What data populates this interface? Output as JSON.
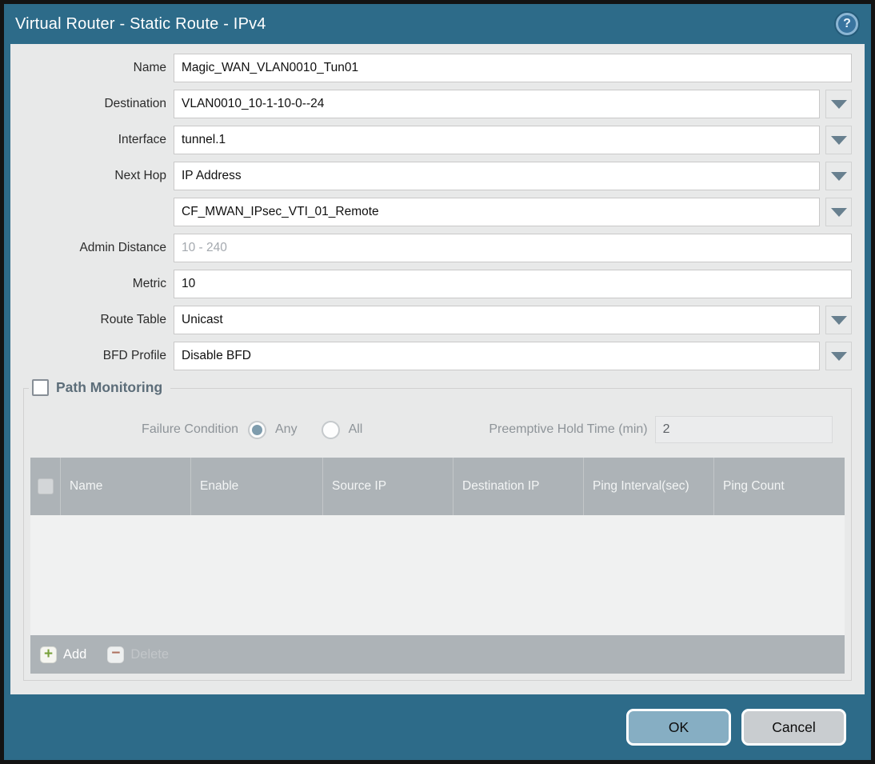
{
  "window": {
    "title": "Virtual Router - Static Route - IPv4",
    "help_icon_glyph": "?"
  },
  "form": {
    "name": {
      "label": "Name",
      "value": "Magic_WAN_VLAN0010_Tun01"
    },
    "destination": {
      "label": "Destination",
      "value": "VLAN0010_10-1-10-0--24"
    },
    "interface": {
      "label": "Interface",
      "value": "tunnel.1"
    },
    "next_hop": {
      "label": "Next Hop",
      "value": "IP Address"
    },
    "next_hop_address": {
      "value": "CF_MWAN_IPsec_VTI_01_Remote"
    },
    "admin_distance": {
      "label": "Admin Distance",
      "placeholder": "10 - 240"
    },
    "metric": {
      "label": "Metric",
      "value": "10"
    },
    "route_table": {
      "label": "Route Table",
      "value": "Unicast"
    },
    "bfd_profile": {
      "label": "BFD Profile",
      "value": "Disable BFD"
    }
  },
  "path_monitoring": {
    "title": "Path Monitoring",
    "enabled": false,
    "failure_condition": {
      "label": "Failure Condition",
      "options": [
        {
          "label": "Any",
          "selected": true
        },
        {
          "label": "All",
          "selected": false
        }
      ]
    },
    "preemptive_hold_time": {
      "label": "Preemptive Hold Time (min)",
      "value": "2"
    },
    "table": {
      "columns": [
        "Name",
        "Enable",
        "Source IP",
        "Destination IP",
        "Ping Interval(sec)",
        "Ping Count"
      ],
      "rows": []
    },
    "toolbar": {
      "add_label": "Add",
      "add_icon_glyph": "+",
      "delete_label": "Delete",
      "delete_icon_glyph": "−"
    }
  },
  "footer": {
    "ok_label": "OK",
    "cancel_label": "Cancel"
  },
  "colors": {
    "frame_teal": "#2d6b89",
    "content_bg": "#e8e9e9",
    "table_header_bg": "#adb3b7",
    "ok_button_bg": "#86aec3",
    "cancel_button_bg": "#c9cdd0",
    "add_plus_green": "#79a13b",
    "delete_minus_red": "#ae7260",
    "radio_selected_fill": "#7e9cad"
  }
}
